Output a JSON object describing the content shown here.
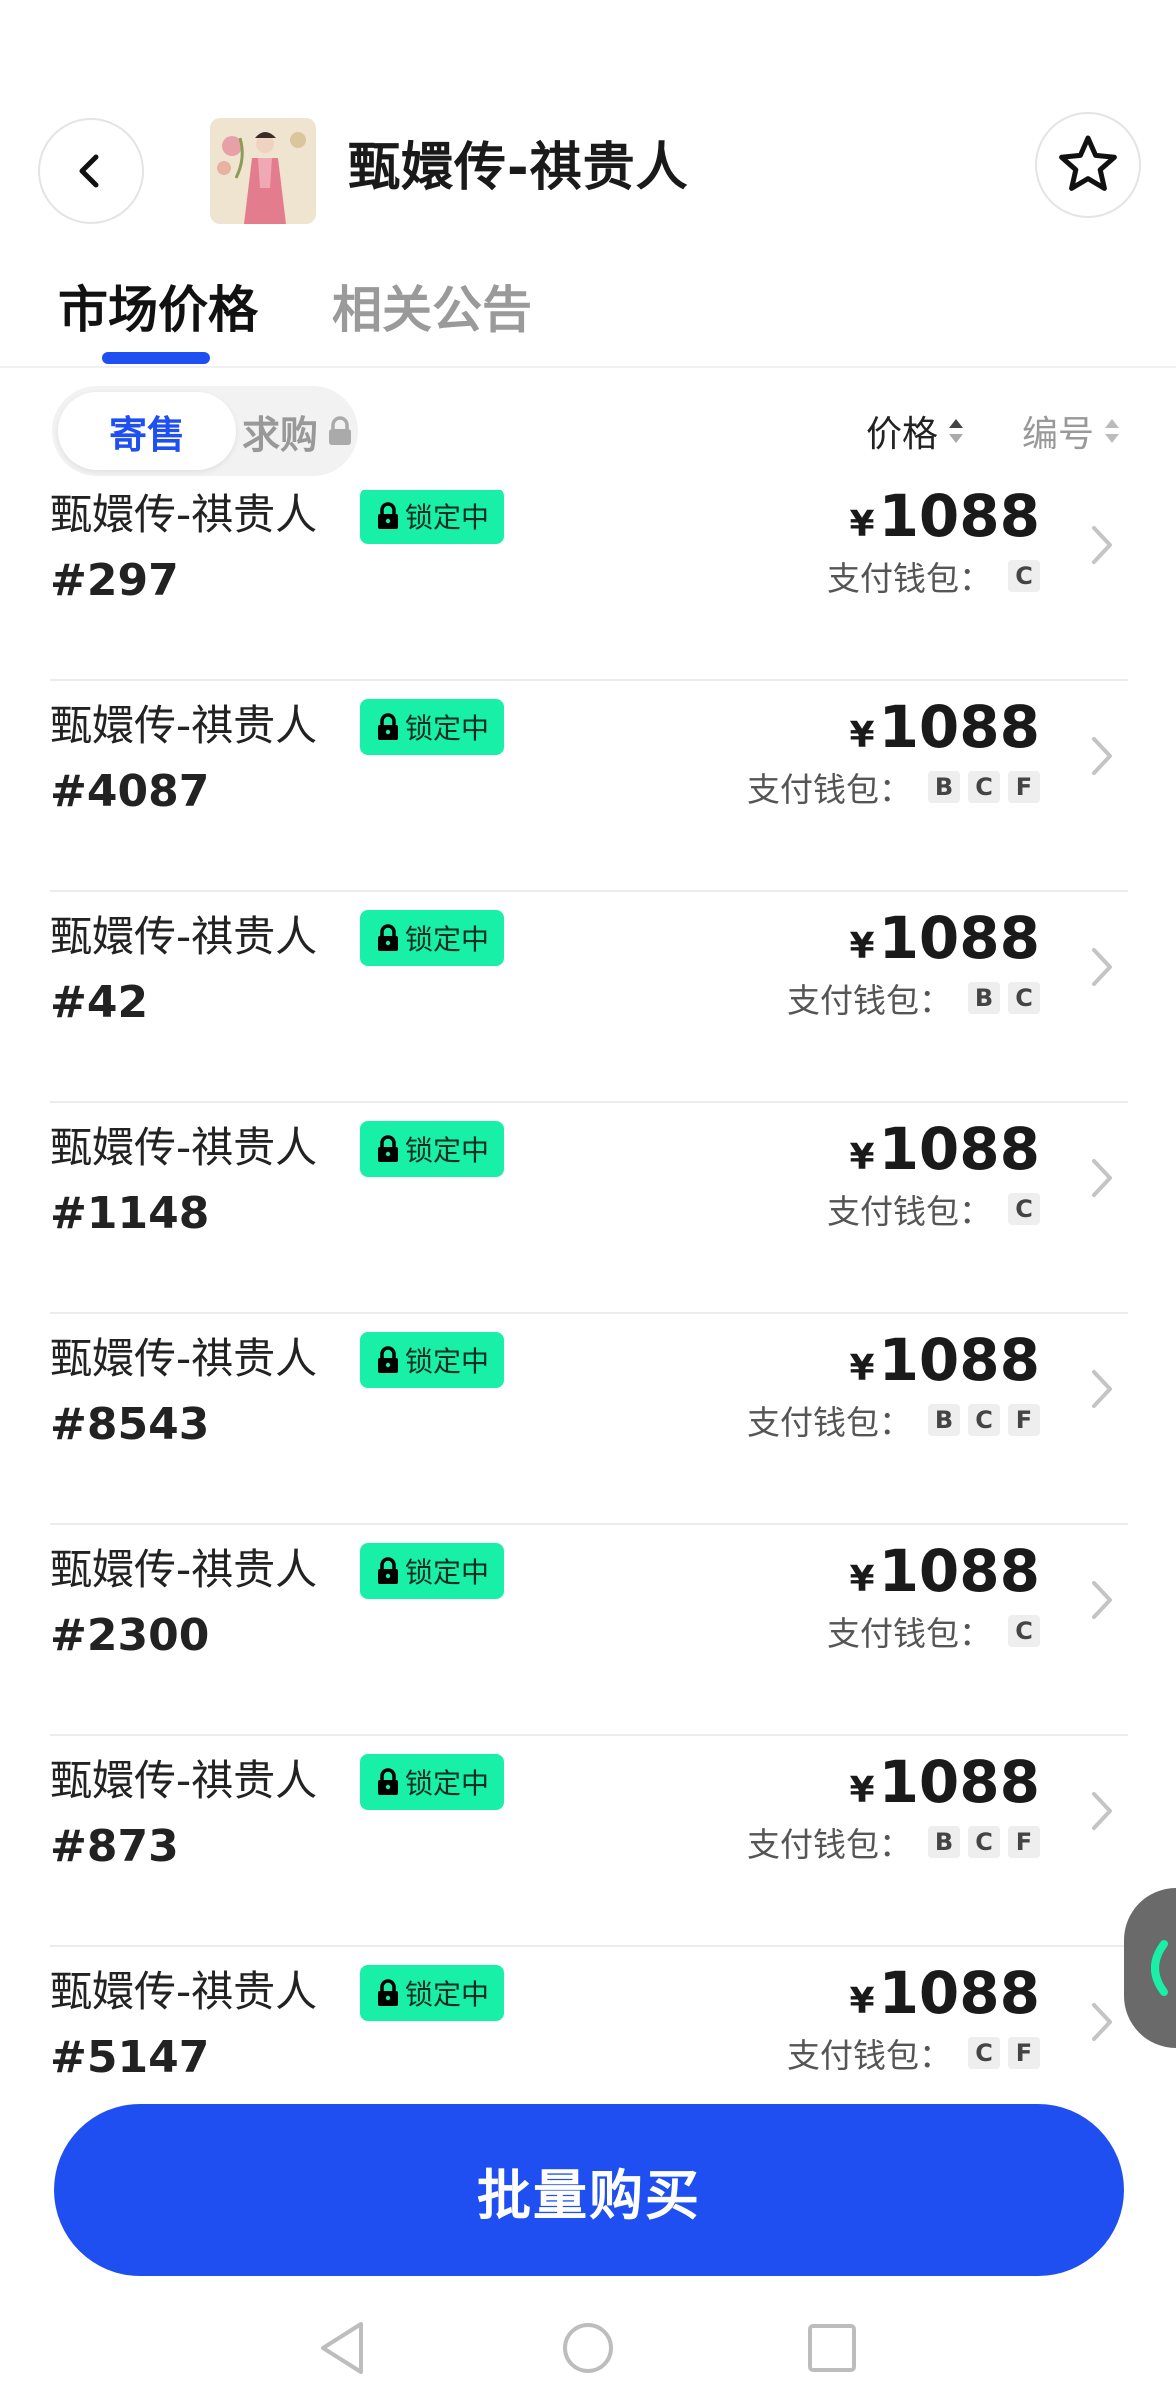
{
  "header": {
    "title": "甄嬛传-祺贵人",
    "back_icon": "chevron-left-icon",
    "favorite_icon": "star-outline-icon"
  },
  "tabs": [
    {
      "label": "市场价格",
      "active": true
    },
    {
      "label": "相关公告",
      "active": false
    }
  ],
  "filter": {
    "segments": [
      {
        "label": "寄售",
        "active": true
      },
      {
        "label": "求购",
        "active": false,
        "locked": true
      }
    ],
    "sort_price": "价格",
    "sort_number": "编号"
  },
  "listings": [
    {
      "name": "甄嬛传-祺贵人",
      "badge": "锁定中",
      "number": "#297",
      "currency": "¥",
      "price": "1088",
      "wallet_label": "支付钱包：",
      "wallets": [
        "C"
      ]
    },
    {
      "name": "甄嬛传-祺贵人",
      "badge": "锁定中",
      "number": "#4087",
      "currency": "¥",
      "price": "1088",
      "wallet_label": "支付钱包：",
      "wallets": [
        "B",
        "C",
        "F"
      ]
    },
    {
      "name": "甄嬛传-祺贵人",
      "badge": "锁定中",
      "number": "#42",
      "currency": "¥",
      "price": "1088",
      "wallet_label": "支付钱包：",
      "wallets": [
        "B",
        "C"
      ]
    },
    {
      "name": "甄嬛传-祺贵人",
      "badge": "锁定中",
      "number": "#1148",
      "currency": "¥",
      "price": "1088",
      "wallet_label": "支付钱包：",
      "wallets": [
        "C"
      ]
    },
    {
      "name": "甄嬛传-祺贵人",
      "badge": "锁定中",
      "number": "#8543",
      "currency": "¥",
      "price": "1088",
      "wallet_label": "支付钱包：",
      "wallets": [
        "B",
        "C",
        "F"
      ]
    },
    {
      "name": "甄嬛传-祺贵人",
      "badge": "锁定中",
      "number": "#2300",
      "currency": "¥",
      "price": "1088",
      "wallet_label": "支付钱包：",
      "wallets": [
        "C"
      ]
    },
    {
      "name": "甄嬛传-祺贵人",
      "badge": "锁定中",
      "number": "#873",
      "currency": "¥",
      "price": "1088",
      "wallet_label": "支付钱包：",
      "wallets": [
        "B",
        "C",
        "F"
      ]
    },
    {
      "name": "甄嬛传-祺贵人",
      "badge": "锁定中",
      "number": "#5147",
      "currency": "¥",
      "price": "1088",
      "wallet_label": "支付钱包：",
      "wallets": [
        "C",
        "F"
      ]
    }
  ],
  "actions": {
    "bulk_buy": "批量购买"
  },
  "colors": {
    "accent": "#1f4ff0",
    "lock_badge": "#17f0a6",
    "tab_inactive": "#9a9a9a"
  }
}
